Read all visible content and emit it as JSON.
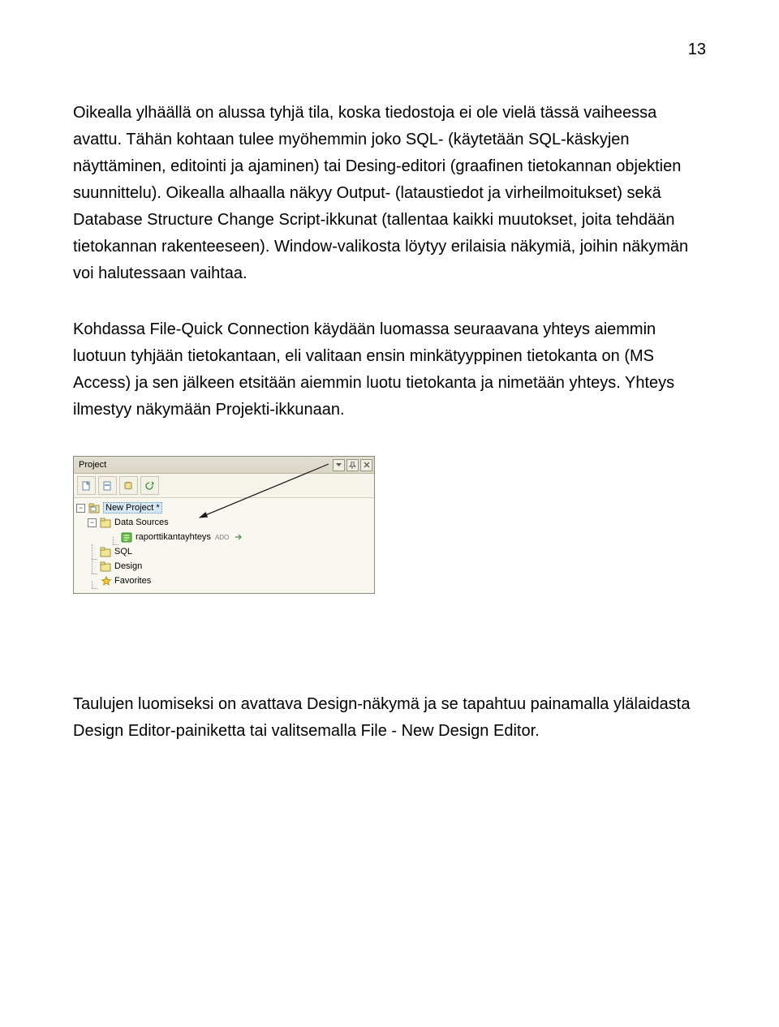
{
  "page_number": "13",
  "paragraphs": {
    "p1": "Oikealla ylhäällä on alussa tyhjä tila, koska tiedostoja ei ole vielä tässä vaiheessa avattu. Tähän kohtaan tulee myöhemmin joko SQL- (käytetään SQL-käskyjen näyttäminen, editointi ja ajaminen) tai Desing-editori (graafinen tietokannan objektien suunnittelu). Oikealla alhaalla näkyy Output- (lataustiedot ja virheilmoitukset) sekä Database Structure Change Script-ikkunat (tallentaa kaikki muutokset, joita tehdään tietokannan rakenteeseen). Window-valikosta löytyy erilaisia näkymiä, joihin näkymän voi halutessaan vaihtaa.",
    "p2": "Kohdassa File-Quick Connection käydään luomassa seuraavana yhteys aiemmin luotuun tyhjään tietokantaan, eli valitaan ensin minkätyyppinen tietokanta on (MS Access) ja sen jälkeen etsitään aiemmin luotu tietokanta ja nimetään yhteys. Yhteys ilmestyy näkymään Projekti-ikkunaan.",
    "p3": "Taulujen luomiseksi on avattava Design-näkymä ja se tapahtuu painamalla ylälaidasta Design Editor-painiketta tai valitsemalla File - New Design Editor."
  },
  "panel": {
    "title": "Project",
    "expander_root": "−",
    "expander_newproj": "−",
    "tree": {
      "new_project": "New Project *",
      "data_sources": "Data Sources",
      "connection": "raporttikantayhteys",
      "connection_tag": "ADO",
      "sql": "SQL",
      "design": "Design",
      "favorites": "Favorites"
    }
  }
}
